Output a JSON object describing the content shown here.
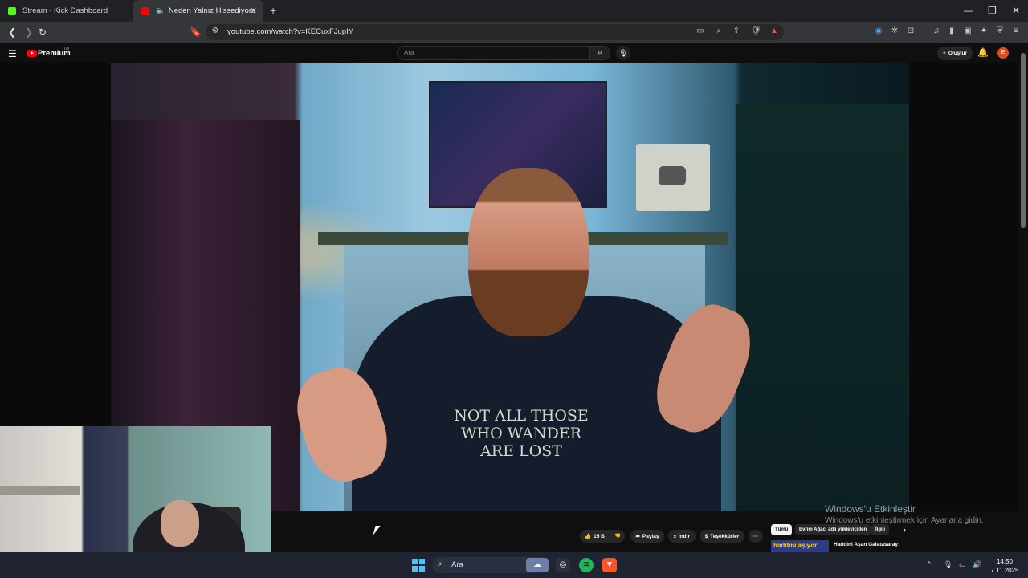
{
  "browser": {
    "tabs": [
      {
        "label": "Stream - Kick Dashboard",
        "favicon": "kick-icon",
        "color": "#53fc18"
      },
      {
        "label": "Neden Yalnız Hissediyorsunuz",
        "favicon": "youtube-icon",
        "color": "#ff0000",
        "active": true
      }
    ],
    "url": "youtube.com/watch?v=KECuxFJupIY"
  },
  "youtube": {
    "brand": "Premium",
    "brand_tm": "TM",
    "search_placeholder": "Ara",
    "create_label": "Oluştur",
    "avatar_letter": "E",
    "accent": "#ff0000"
  },
  "video": {
    "shirt_text": "NOT ALL THOSE WHO WANDER ARE LOST"
  },
  "actions": {
    "like_count": "15 B",
    "share": "Paylaş",
    "download": "İndir",
    "thanks": "Teşekkürler",
    "more": "···"
  },
  "chips": [
    "Tümü",
    "Evrim Ağacı adlı yükleyiciden",
    "İlgili"
  ],
  "recommendation": {
    "thumb_text": "haddini aşıyor",
    "title": "Haddini Aşan Galatasaray:"
  },
  "watermark": {
    "line1": "Windows'u Etkinleştir",
    "line2": "Windows'u etkinleştirmek için Ayarlar'a gidin."
  },
  "taskbar": {
    "search_label": "Ara",
    "time": "14:50",
    "date": "7.11.2025"
  }
}
